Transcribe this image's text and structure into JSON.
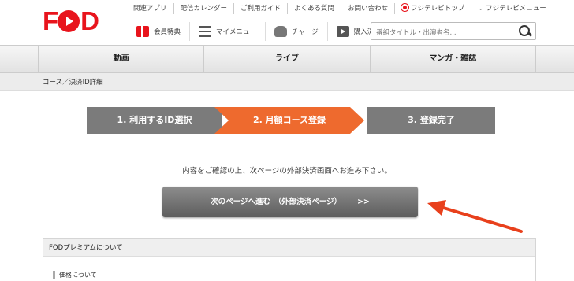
{
  "header": {
    "logo": "FOD",
    "top_links": [
      "関連アプリ",
      "配信カレンダー",
      "ご利用ガイド",
      "よくある質問",
      "お問い合わせ",
      "フジテレビトップ",
      "フジテレビメニュー"
    ],
    "sub_nav": [
      "会員特典",
      "マイメニュー",
      "チャージ",
      "購入済"
    ],
    "search_placeholder": "番組タイトル・出演者名..."
  },
  "main_nav": [
    "動画",
    "ライブ",
    "マンガ・雑誌"
  ],
  "breadcrumb": "コース／決済ID詳細",
  "steps": [
    "1. 利用するID選択",
    "2. 月額コース登録",
    "3. 登録完了"
  ],
  "notice": "内容をご確認の上、次ページの外部決済画面へお進み下さい。",
  "proceed_button": {
    "label": "次のページへ進む　（外部決済ページ）",
    "chevrons": ">>"
  },
  "about": {
    "title": "FODプレミアムについて",
    "price_label": "価格について"
  },
  "colors": {
    "brand_red": "#e8141c",
    "active_step": "#ee6a2e",
    "inactive_step": "#7b7b7b",
    "annotation_arrow": "#e8401c"
  }
}
